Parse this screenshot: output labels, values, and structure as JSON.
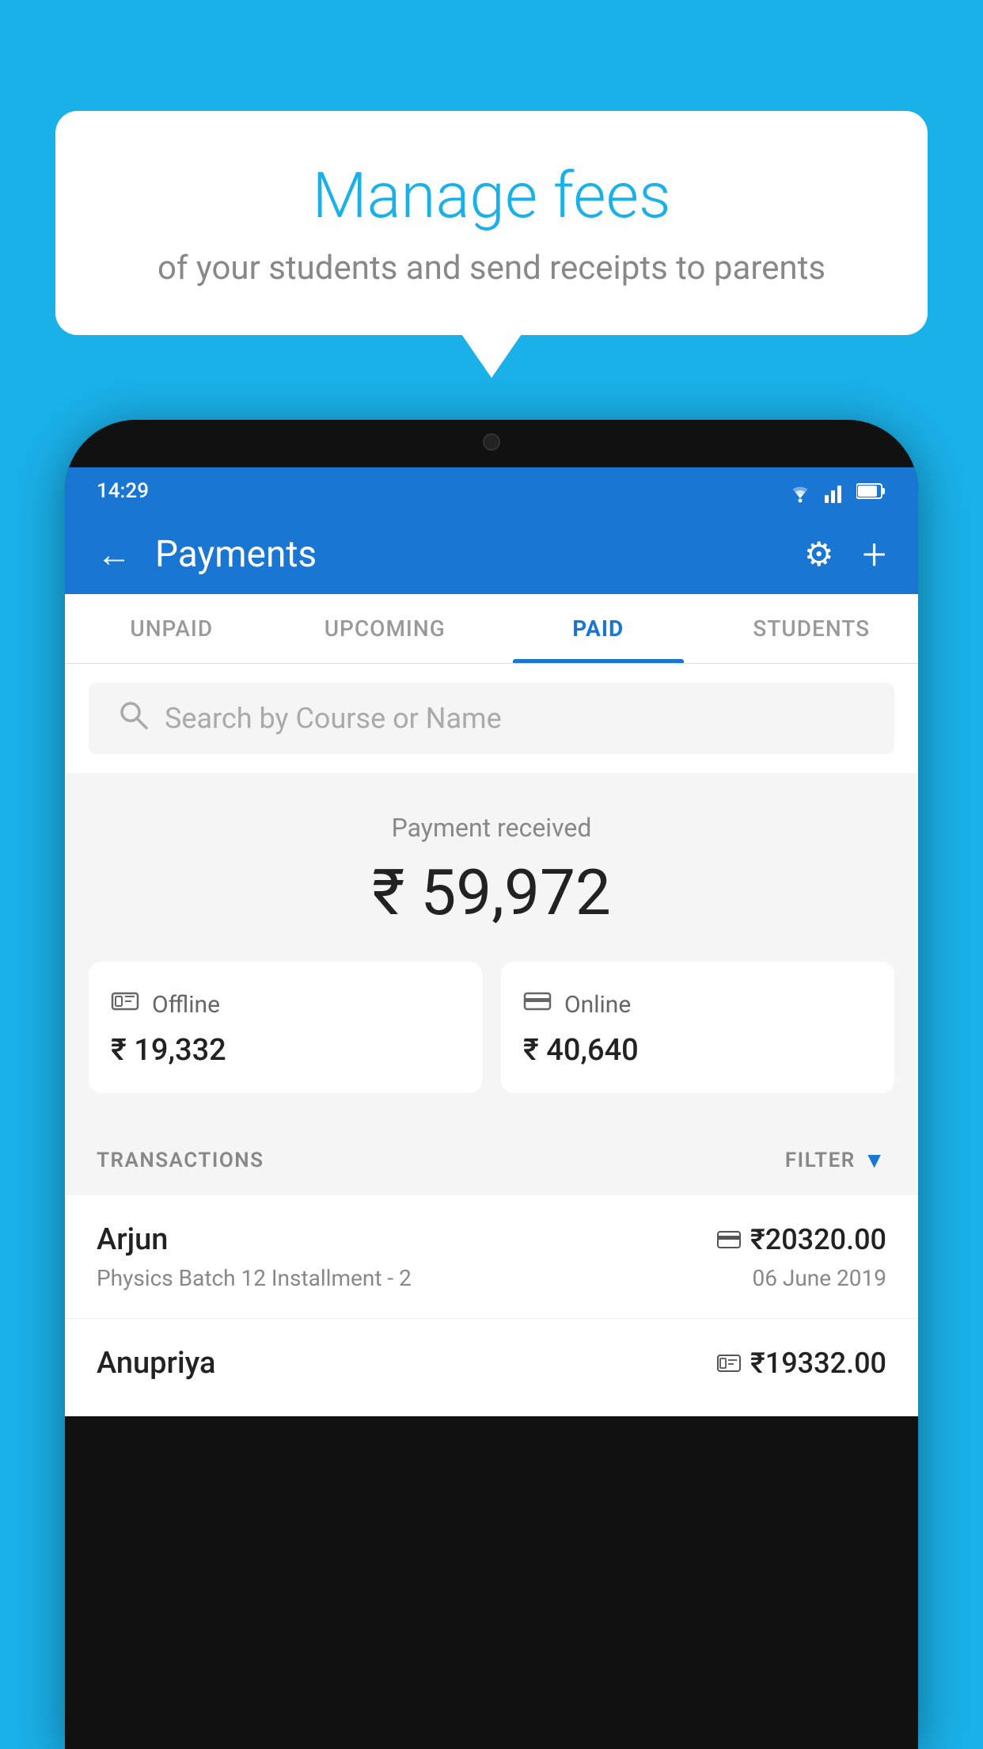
{
  "background_color": "#1ab0e8",
  "speech_bubble": {
    "title": "Manage fees",
    "subtitle": "of your students and send receipts to parents"
  },
  "status_bar": {
    "time": "14:29",
    "icons": [
      "wifi",
      "signal",
      "battery"
    ]
  },
  "header": {
    "title": "Payments",
    "back_label": "←",
    "settings_label": "⚙",
    "add_label": "+"
  },
  "tabs": [
    {
      "label": "UNPAID",
      "active": false
    },
    {
      "label": "UPCOMING",
      "active": false
    },
    {
      "label": "PAID",
      "active": true
    },
    {
      "label": "STUDENTS",
      "active": false
    }
  ],
  "search": {
    "placeholder": "Search by Course or Name"
  },
  "payment_summary": {
    "received_label": "Payment received",
    "total_amount": "₹ 59,972",
    "offline": {
      "label": "Offline",
      "amount": "₹ 19,332"
    },
    "online": {
      "label": "Online",
      "amount": "₹ 40,640"
    }
  },
  "transactions": {
    "section_label": "TRANSACTIONS",
    "filter_label": "FILTER",
    "items": [
      {
        "name": "Arjun",
        "course": "Physics Batch 12 Installment - 2",
        "amount": "₹20320.00",
        "date": "06 June 2019",
        "payment_type": "card"
      },
      {
        "name": "Anupriya",
        "course": "",
        "amount": "₹19332.00",
        "date": "",
        "payment_type": "cash"
      }
    ]
  }
}
